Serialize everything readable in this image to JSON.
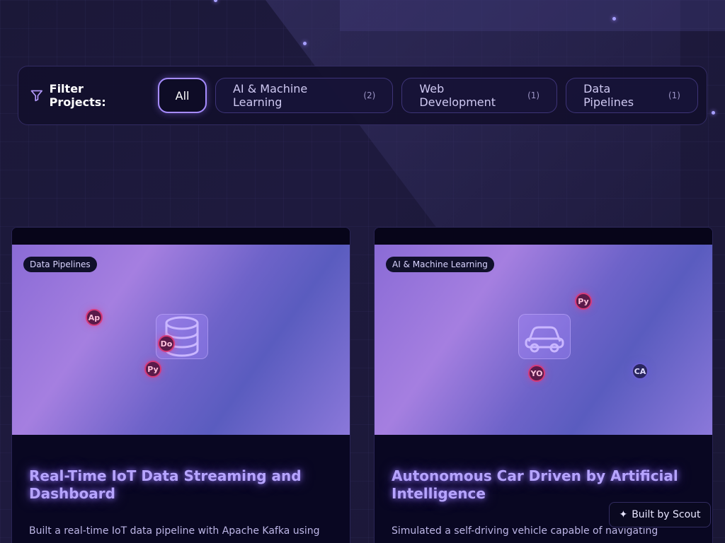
{
  "filter": {
    "label": "Filter Projects:",
    "chips": [
      {
        "label": "All",
        "count": ""
      },
      {
        "label": "AI & Machine Learning",
        "count": "(2)"
      },
      {
        "label": "Web Development",
        "count": "(1)"
      },
      {
        "label": "Data Pipelines",
        "count": "(1)"
      }
    ]
  },
  "cards": [
    {
      "category": "Data Pipelines",
      "title": "Real-Time IoT Data Streaming and Dashboard",
      "description": "Built a real-time IoT data pipeline with Apache Kafka using",
      "icon": "database-icon",
      "tech": [
        "Ap",
        "Do",
        "Py"
      ]
    },
    {
      "category": "AI & Machine Learning",
      "title": "Autonomous Car Driven by Artificial Intelligence",
      "description": "Simulated a self-driving vehicle capable of navigating",
      "icon": "car-icon",
      "tech": [
        "Py",
        "YO",
        "CA"
      ]
    }
  ],
  "footer": {
    "scout_label": "Built by Scout",
    "scout_icon": "sparkle-icon"
  },
  "colors": {
    "accent": "#a68cff",
    "background": "#1a1733",
    "card": "#090722",
    "tech_bubble": "#d53a7a"
  }
}
